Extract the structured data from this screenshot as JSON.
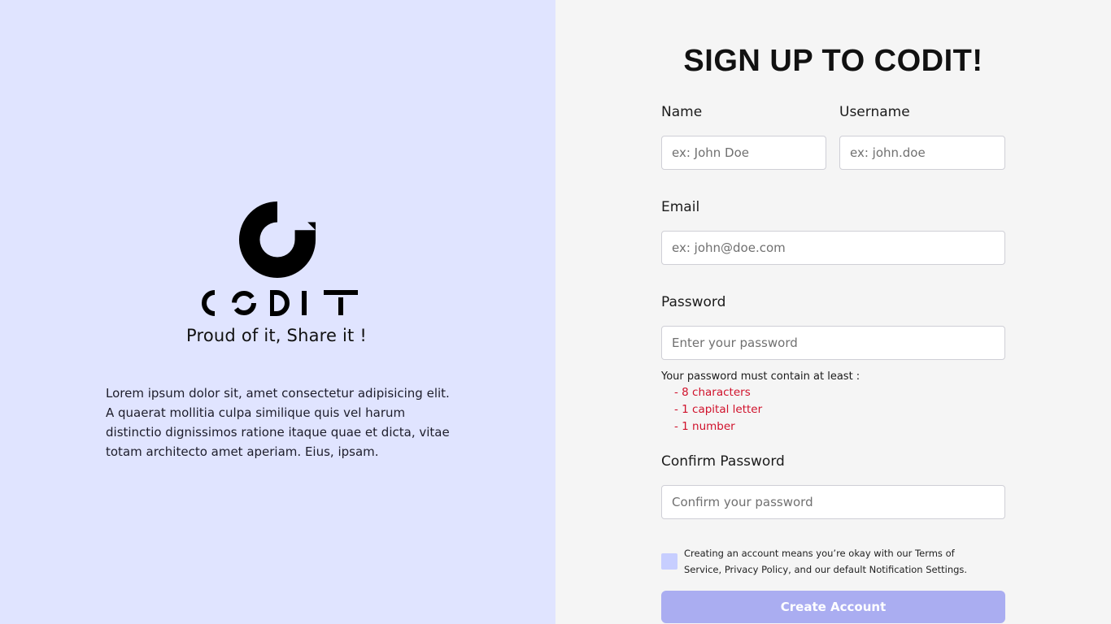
{
  "brand": {
    "wordmark": "CODIT",
    "tagline": "Proud of it, Share it !",
    "intro": "Lorem ipsum dolor sit, amet consectetur adipisicing elit. A quaerat mollitia culpa similique quis vel harum distinctio dignissimos ratione itaque quae et dicta, vitae totam architecto amet aperiam. Eius, ipsam."
  },
  "form": {
    "title": "SIGN UP TO CODIT!",
    "name": {
      "label": "Name",
      "placeholder": "ex: John Doe"
    },
    "username": {
      "label": "Username",
      "placeholder": "ex: john.doe"
    },
    "email": {
      "label": "Email",
      "placeholder": "ex: john@doe.com"
    },
    "password": {
      "label": "Password",
      "placeholder": "Enter your password"
    },
    "password_rules": {
      "heading": "Your password must contain at least :",
      "rules": [
        "- 8 characters",
        "- 1 capital letter",
        "- 1 number"
      ]
    },
    "confirm_password": {
      "label": "Confirm Password",
      "placeholder": "Confirm your password"
    },
    "agreement": "Creating an account means you’re okay with our Terms of Service, Privacy Policy, and our default Notification Settings.",
    "submit_label": "Create Account"
  },
  "colors": {
    "left_bg": "#e0e4ff",
    "right_bg": "#f5f5f5",
    "rule_red": "#d0112b",
    "button": "#aaadf1",
    "checkbox": "#c7ceff"
  }
}
